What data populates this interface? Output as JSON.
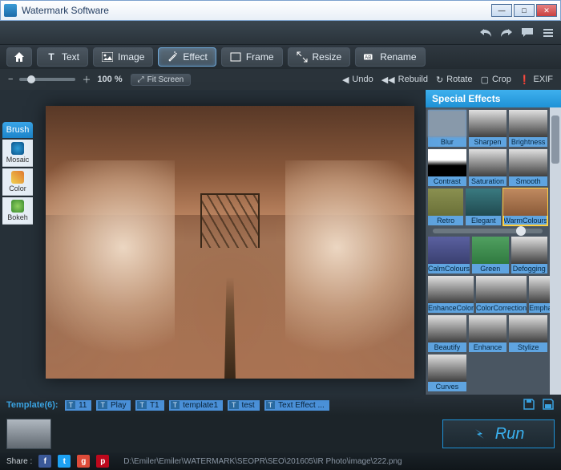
{
  "titlebar": {
    "title": "Watermark Software"
  },
  "toprow": {},
  "tabs": {
    "home": "",
    "text": "Text",
    "image": "Image",
    "effect": "Effect",
    "frame": "Frame",
    "resize": "Resize",
    "rename": "Rename"
  },
  "zoom": {
    "percent": "100 %",
    "fit": "Fit Screen",
    "undo": "Undo",
    "rebuild": "Rebuild",
    "rotate": "Rotate",
    "crop": "Crop",
    "exif": "EXIF"
  },
  "brush": {
    "label": "Brush",
    "tools": {
      "mosaic": "Mosaic",
      "color": "Color",
      "bokeh": "Bokeh"
    }
  },
  "panel": {
    "title": "Special Effects",
    "effects": [
      [
        "Blur",
        "Sharpen",
        "Brightness"
      ],
      [
        "Contrast",
        "Saturation",
        "Smooth"
      ],
      [
        "Retro",
        "Elegant",
        "WarmColours"
      ],
      [
        "CalmColours",
        "Green",
        "Defogging"
      ],
      [
        "EnhanceColor",
        "ColorCorrection",
        "Emphasize"
      ],
      [
        "Beautify",
        "Enhance",
        "Stylize"
      ],
      [
        "Curves",
        "",
        ""
      ]
    ],
    "selected": "WarmColours"
  },
  "templates": {
    "label": "Template(6):",
    "items": [
      "11",
      "Play",
      "T1",
      "template1",
      "test",
      "Text Effect ..."
    ]
  },
  "run": {
    "label": "Run"
  },
  "status": {
    "share": "Share :",
    "path": "D:\\Emiler\\Emiler\\WATERMARK\\SEOPR\\SEO\\201605\\IR Photo\\image\\222.png"
  }
}
